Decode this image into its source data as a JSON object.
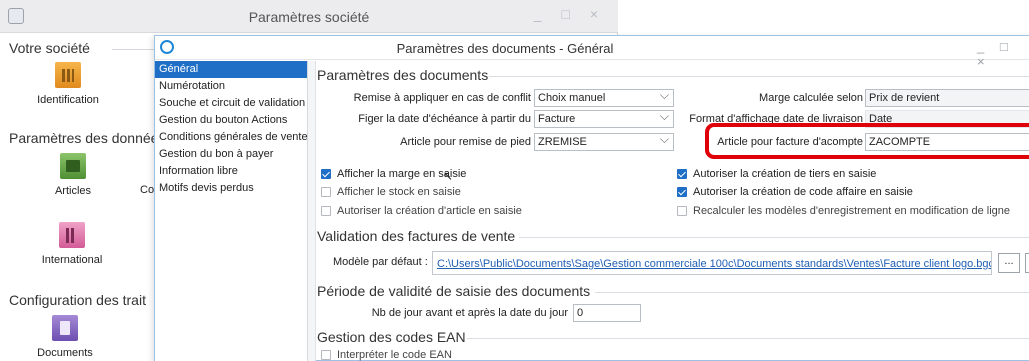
{
  "back_window": {
    "title": "Paramètres société",
    "sections": [
      {
        "title": "Votre société"
      },
      {
        "title": "Paramètres des donnée"
      },
      {
        "title": "Configuration des trait"
      }
    ],
    "tiles": [
      {
        "label": "Identification",
        "icon": "building-icon"
      },
      {
        "label": "Articles",
        "icon": "box-icon"
      },
      {
        "label": "Co",
        "icon": ""
      },
      {
        "label": "International",
        "icon": "flags-icon"
      },
      {
        "label": "Documents",
        "icon": "document-icon"
      }
    ]
  },
  "front_window": {
    "title": "Paramètres des documents - Général",
    "nav_items": [
      "Général",
      "Numérotation",
      "Souche et circuit de validation",
      "Gestion du bouton Actions",
      "Conditions générales de vente",
      "Gestion du bon à payer",
      "Information libre",
      "Motifs devis perdus"
    ],
    "selected_nav": "Général",
    "params": {
      "title": "Paramètres des documents",
      "remise_label": "Remise à appliquer en cas de conflit",
      "remise_value": "Choix manuel",
      "echeance_label": "Figer la date d'échéance à partir du",
      "echeance_value": "Facture",
      "article_remise_label": "Article pour remise de pied",
      "article_remise_value": "ZREMISE",
      "marge_label": "Marge calculée selon",
      "marge_value": "Prix de revient",
      "format_label": "Format d'affichage date de livraison",
      "format_value": "Date",
      "acompte_label": "Article pour facture d'acompte",
      "acompte_value": "ZACOMPTE"
    },
    "checkboxes": [
      {
        "label": "Afficher la marge en saisie",
        "checked": true
      },
      {
        "label": "Afficher le stock en saisie",
        "checked": false
      },
      {
        "label": "Autoriser la création d'article en saisie",
        "checked": false
      },
      {
        "label": "Autoriser la création de tiers en saisie",
        "checked": true
      },
      {
        "label": "Autoriser la création de code affaire en saisie",
        "checked": true
      },
      {
        "label": "Recalculer les modèles d'enregistrement en modification de ligne",
        "checked": false
      }
    ],
    "validation": {
      "title": "Validation des factures de vente",
      "model_label": "Modèle par défaut :",
      "model_path": "C:\\Users\\Public\\Documents\\Sage\\Gestion commerciale 100c\\Documents standards\\Ventes\\Facture client logo.bgc",
      "browse_label": "..."
    },
    "periode": {
      "title": "Période de validité de saisie des documents",
      "days_label": "Nb de jour avant et après la date du jour",
      "days_value": "0"
    },
    "ean": {
      "title": "Gestion des codes EAN",
      "checkbox_label": "Interpréter le code EAN",
      "checked": false
    }
  },
  "colors": {
    "accent": "#1f6fc6",
    "highlight": "#e0000a"
  }
}
